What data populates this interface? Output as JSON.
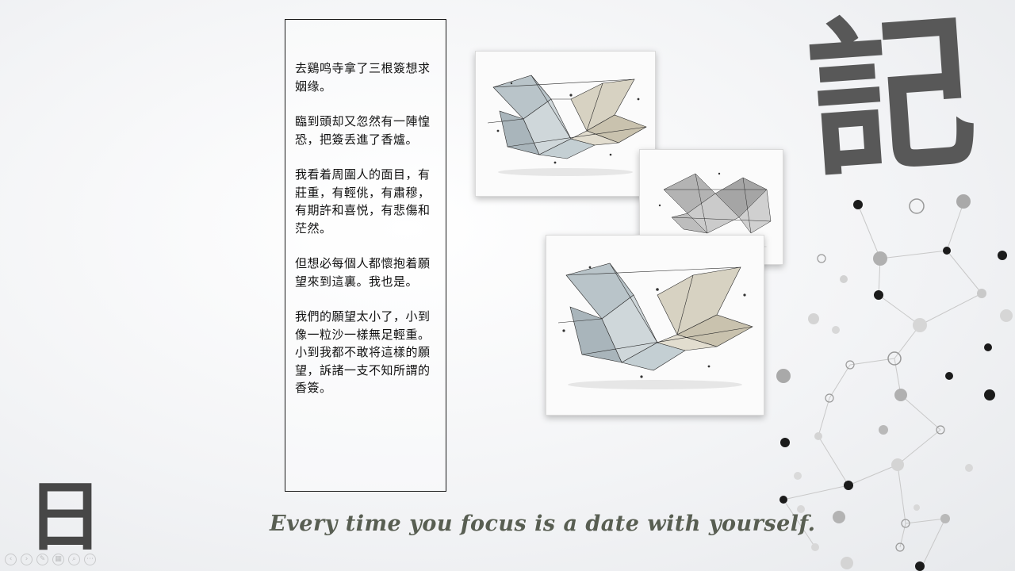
{
  "slide": {
    "poem": {
      "paragraphs": [
        "去鷄鸣寺拿了三根簽想求姻缘。",
        "臨到頭却又忽然有一陣惶恐，把簽丢進了香爐。",
        "我看着周圍人的面目，有莊重，有輕佻，有肅穆，有期許和喜悦，有悲傷和茫然。",
        "但想必每個人都懷抱着願望來到這裏。我也是。",
        "我們的願望太小了，小到像一粒沙一樣無足輕重。小到我都不敢将這樣的願望，訴諸一支不知所謂的香簽。"
      ]
    },
    "calligraphy": {
      "ji": "記",
      "ri": "日"
    },
    "tagline": "Every time you focus is a date with yourself."
  },
  "toolbar": {
    "icons": [
      "prev-icon",
      "next-icon",
      "pen-icon",
      "slides-icon",
      "zoom-icon",
      "more-icon"
    ],
    "glyphs": [
      "‹",
      "›",
      "✎",
      "▦",
      "⌕",
      "⋯"
    ]
  },
  "colors": {
    "tagline": "#585e52",
    "calligraphy": "#4a4a4a",
    "border": "#1a1a1a"
  }
}
